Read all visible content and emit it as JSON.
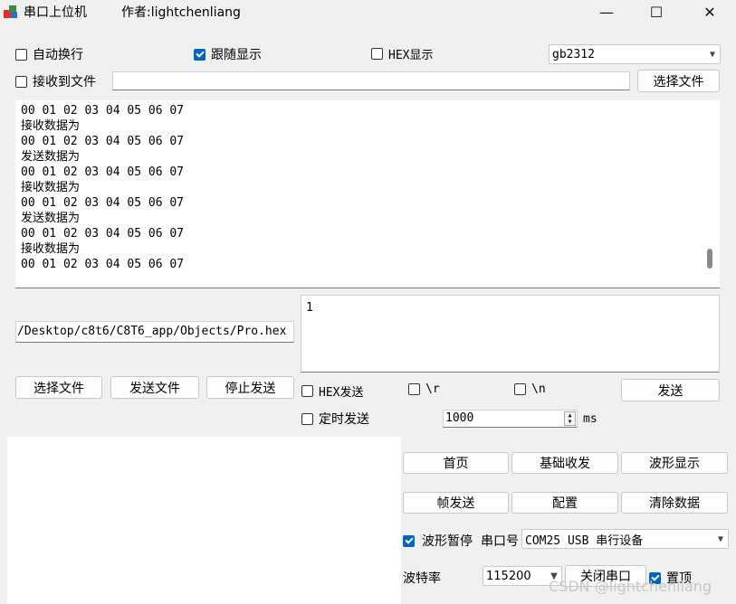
{
  "titlebar": {
    "app_title": "串口上位机",
    "author": "作者:lightchenliang",
    "minimize_glyph": "—",
    "maximize_glyph": "☐",
    "close_glyph": "✕"
  },
  "options": {
    "auto_wrap": "自动换行",
    "follow_display": "跟随显示",
    "hex_display": "HEX显示",
    "encoding": "gb2312",
    "receive_to_file": "接收到文件",
    "receive_file_path": "",
    "choose_file": "选择文件"
  },
  "receive": {
    "lines": [
      "00 01 02 03 04 05 06 07",
      "接收数据为",
      "00 01 02 03 04 05 06 07",
      "发送数据为",
      "00 01 02 03 04 05 06 07",
      "接收数据为",
      "00 01 02 03 04 05 06 07",
      "发送数据为",
      "00 01 02 03 04 05 06 07",
      "接收数据为",
      "00 01 02 03 04 05 06 07"
    ]
  },
  "file_send": {
    "path": "/Desktop/c8t6/C8T6_app/Objects/Pro.hex",
    "choose_file": "选择文件",
    "send_file": "发送文件",
    "stop_send": "停止发送"
  },
  "send": {
    "text": "1",
    "hex_send": "HEX发送",
    "cr": "\\r",
    "lf": "\\n",
    "send_button": "发送",
    "timed_send": "定时发送",
    "interval": "1000",
    "unit": "ms"
  },
  "nav": {
    "home": "首页",
    "basic": "基础收发",
    "waveform": "波形显示",
    "frame_send": "帧发送",
    "config": "配置",
    "clear_data": "清除数据"
  },
  "serial": {
    "wave_pause": "波形暂停",
    "port_label": "串口号",
    "port_value": "COM25 USB 串行设备",
    "baud_label": "波特率",
    "baud_value": "115200",
    "close_port": "关闭串口",
    "topmost": "置顶"
  },
  "watermark": "CSDN @lightchenliang",
  "colors": {
    "accent": "#0067c0"
  }
}
